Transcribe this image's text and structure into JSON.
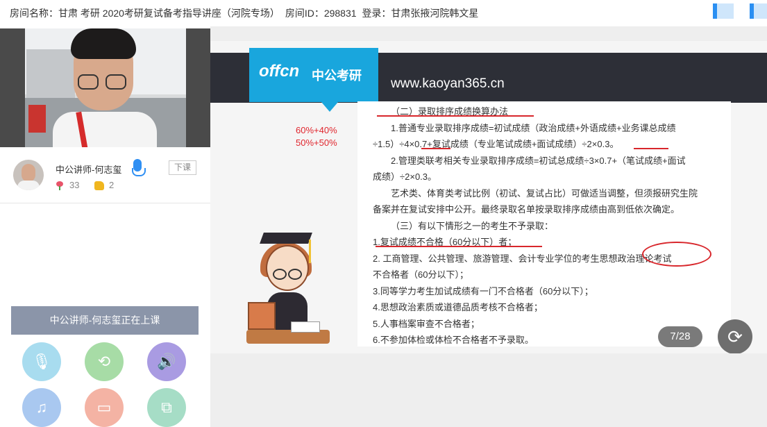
{
  "header": {
    "room_name_label": "房间名称：甘肃 考研 2020考研复试备考指导讲座（河院专场）",
    "room_id_label": "房间ID：298831",
    "login_label": "登录：甘肃张掖河院韩文星"
  },
  "teacher": {
    "name": "中公讲师-何志玺",
    "down_button": "下课",
    "flowers": "33",
    "likes": "2"
  },
  "status_button": "中公讲师-何志玺正在上课",
  "controls": [
    {
      "name": "mic-toggle",
      "icon": "mic-off-icon",
      "color": "#a8dcef"
    },
    {
      "name": "camera-switch",
      "icon": "camera-rotate-icon",
      "color": "#a7dca6"
    },
    {
      "name": "speaker",
      "icon": "speaker-icon",
      "color": "#a99be2"
    },
    {
      "name": "music",
      "icon": "music-icon",
      "color": "#a9c8f0"
    },
    {
      "name": "video",
      "icon": "video-icon",
      "color": "#f4b3a4"
    },
    {
      "name": "screen-share",
      "icon": "screen-share-icon",
      "color": "#a6ddc6"
    }
  ],
  "slide": {
    "logo": "offcn",
    "logo_cn": "中公考研",
    "url": "www.kaoyan365.cn",
    "pct1": "60%+40%",
    "pct2": "50%+50%",
    "lines": [
      "（二）录取排序成绩换算办法",
      "1.普通专业录取排序成绩=初试成绩（政治成绩+外语成绩+业务课总成绩",
      "÷1.5）÷4×0.7+复试成绩（专业笔试成绩+面试成绩）÷2×0.3。",
      "2.管理类联考相关专业录取排序成绩=初试总成绩÷3×0.7+（笔试成绩+面试",
      "成绩）÷2×0.3。",
      "艺术类、体育类考试比例（初试、复试占比）可做适当调整，但须报研究生院",
      "备案并在复试安排中公开。最终录取名单按录取排序成绩由高到低依次确定。",
      "（三）有以下情形之一的考生不予录取：",
      "1.复试成绩不合格（60分以下）者；",
      "2. 工商管理、公共管理、旅游管理、会计专业学位的考生思想政治理论考试",
      "不合格者（60分以下）；",
      "3.同等学力考生加试成绩有一门不合格者（60分以下）；",
      "4.思想政治素质或道德品质考核不合格者；",
      "5.人事档案审查不合格者；",
      "6.不参加体检或体检不合格者不予录取。"
    ],
    "page": "7/28"
  }
}
